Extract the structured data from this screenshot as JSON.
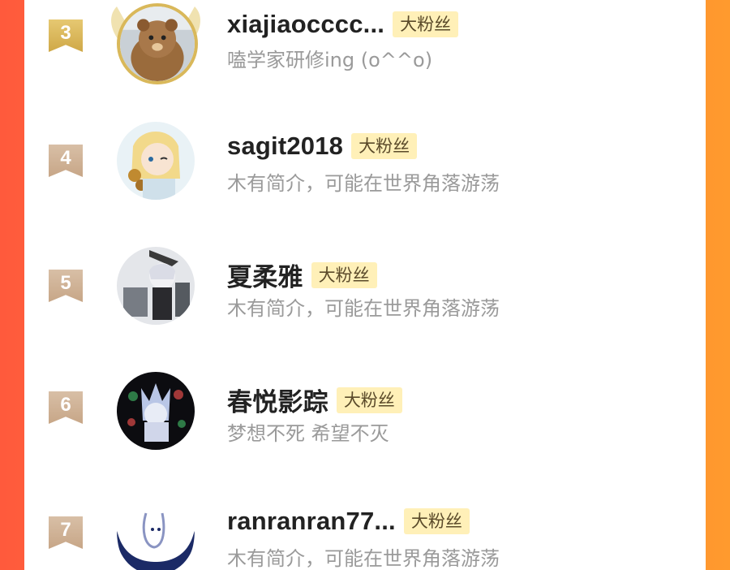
{
  "fans": [
    {
      "rank": "3",
      "name": "xiajiaocccc...",
      "badge": "大粉丝",
      "bio": "嗑学家研修ing (o^^o)"
    },
    {
      "rank": "4",
      "name": "sagit2018",
      "badge": "大粉丝",
      "bio": "木有简介，可能在世界角落游荡"
    },
    {
      "rank": "5",
      "name": "夏柔雅",
      "badge": "大粉丝",
      "bio": "木有简介，可能在世界角落游荡"
    },
    {
      "rank": "6",
      "name": "春悦影踪",
      "badge": "大粉丝",
      "bio": "梦想不死 希望不灭"
    },
    {
      "rank": "7",
      "name": "ranranran77...",
      "badge": "大粉丝",
      "bio": "木有简介，可能在世界角落游荡"
    }
  ],
  "colors": {
    "gold_rank": "#d9b85a",
    "tan_rank": "#cdb092",
    "badge_bg": "#fff0b8",
    "bio_gray": "#9a9a9a",
    "frame_left": "#ff5a3c",
    "frame_right": "#ff9a2e"
  },
  "icons": [
    "rank-ribbon-icon",
    "avatar-wings-icon"
  ]
}
